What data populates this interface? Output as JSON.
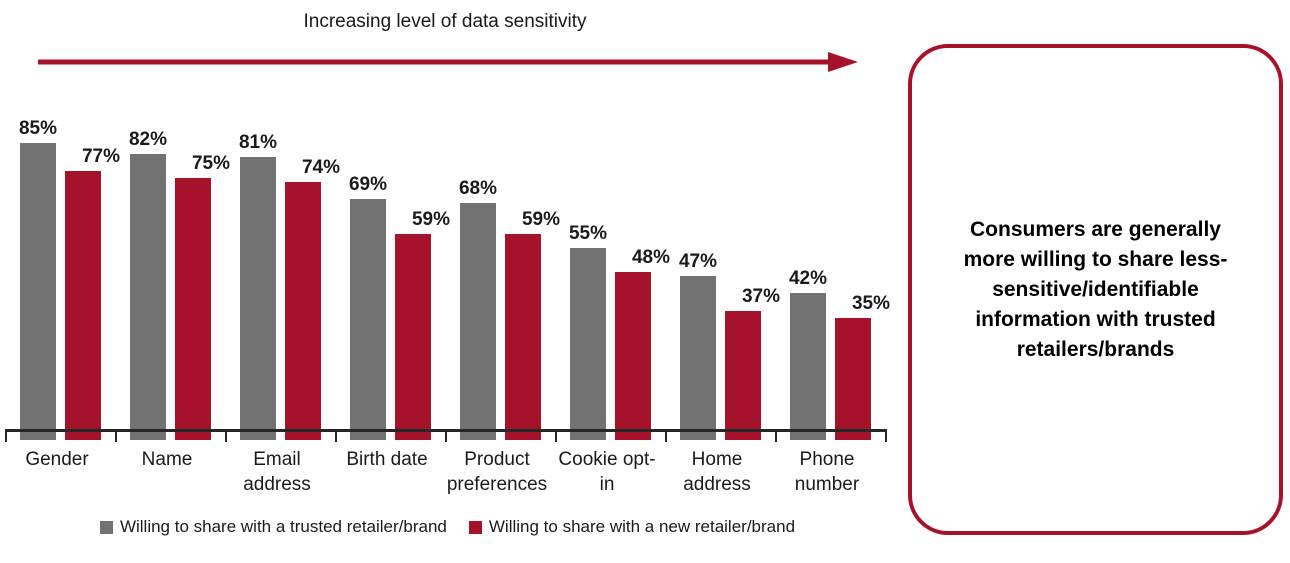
{
  "chart_data": {
    "type": "bar",
    "title": "Increasing level of data sensitivity",
    "xlabel": "",
    "ylabel": "",
    "ylim": [
      0,
      100
    ],
    "grid": false,
    "legend_position": "bottom",
    "categories": [
      "Gender",
      "Name",
      "Email address",
      "Birth date",
      "Product preferences",
      "Cookie opt-in",
      "Home address",
      "Phone number"
    ],
    "category_lines": [
      [
        "Gender",
        ""
      ],
      [
        "Name",
        ""
      ],
      [
        "Email",
        "address"
      ],
      [
        "Birth date",
        ""
      ],
      [
        "Product",
        "preferences"
      ],
      [
        "Cookie opt-",
        "in"
      ],
      [
        "Home",
        "address"
      ],
      [
        "Phone",
        "number"
      ]
    ],
    "series": [
      {
        "name": "Willing to share with a trusted retailer/brand",
        "color": "#727272",
        "values": [
          85,
          82,
          81,
          69,
          68,
          55,
          47,
          42
        ],
        "labels": [
          "85%",
          "82%",
          "81%",
          "69%",
          "68%",
          "55%",
          "47%",
          "42%"
        ]
      },
      {
        "name": "Willing to share with a new retailer/brand",
        "color": "#A5132B",
        "values": [
          77,
          75,
          74,
          59,
          59,
          48,
          37,
          35
        ],
        "labels": [
          "77%",
          "75%",
          "74%",
          "59%",
          "59%",
          "48%",
          "37%",
          "35%"
        ]
      }
    ]
  },
  "title": {
    "text": "Increasing level of data sensitivity"
  },
  "arrow": {
    "name": "increasing-sensitivity-arrow",
    "color": "#A5132B",
    "direction": "right"
  },
  "legend": [
    {
      "label": "Willing to share with a trusted retailer/brand",
      "color": "#727272"
    },
    {
      "label": "Willing to share with a new retailer/brand",
      "color": "#A5132B"
    }
  ],
  "callout": {
    "text": "Consumers are generally more willing to share less-sensitive/identifiable information with trusted retailers/brands",
    "border_color": "#A5132B"
  }
}
